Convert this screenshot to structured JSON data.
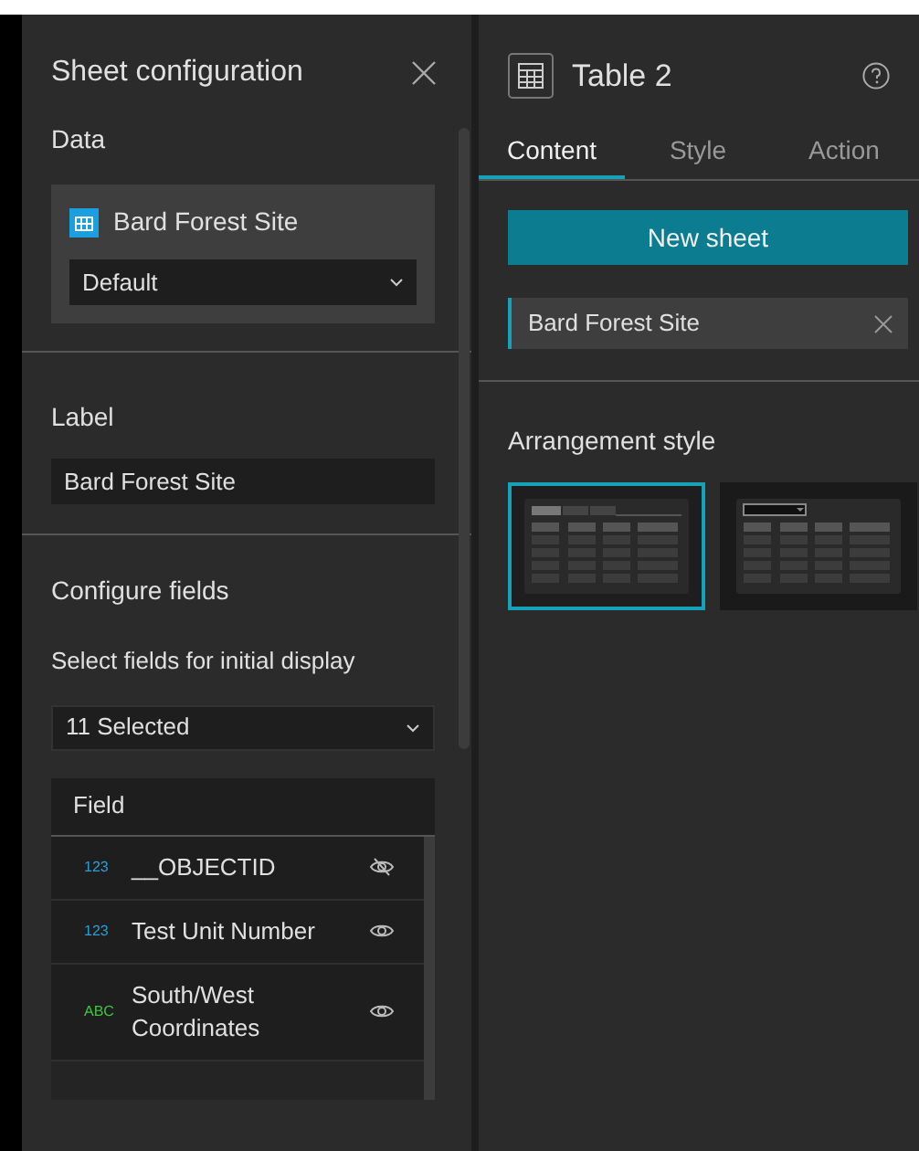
{
  "left_panel": {
    "title": "Sheet configuration",
    "data_section": {
      "heading": "Data",
      "source": "Bard Forest Site",
      "view": "Default"
    },
    "label_section": {
      "heading": "Label",
      "value": "Bard Forest Site"
    },
    "fields_section": {
      "heading": "Configure fields",
      "hint": "Select fields for initial display",
      "selection": "11 Selected",
      "column": "Field",
      "fields": [
        {
          "kind": "number",
          "type_label": "123",
          "name": "__OBJECTID",
          "visible": false
        },
        {
          "kind": "number",
          "type_label": "123",
          "name": "Test Unit Number",
          "visible": true
        },
        {
          "kind": "text",
          "type_label": "ABC",
          "name": "South/West Coordinates",
          "visible": true
        }
      ]
    }
  },
  "right_panel": {
    "title": "Table 2",
    "tabs": [
      {
        "label": "Content",
        "selected": true
      },
      {
        "label": "Style",
        "selected": false
      },
      {
        "label": "Action",
        "selected": false
      }
    ],
    "new_sheet_button": "New sheet",
    "sheets": [
      {
        "label": "Bard Forest Site",
        "selected": true
      }
    ],
    "arrangement": {
      "heading": "Arrangement style",
      "options": [
        {
          "kind": "tabs",
          "selected": true
        },
        {
          "kind": "dropdown",
          "selected": false
        }
      ]
    }
  }
}
